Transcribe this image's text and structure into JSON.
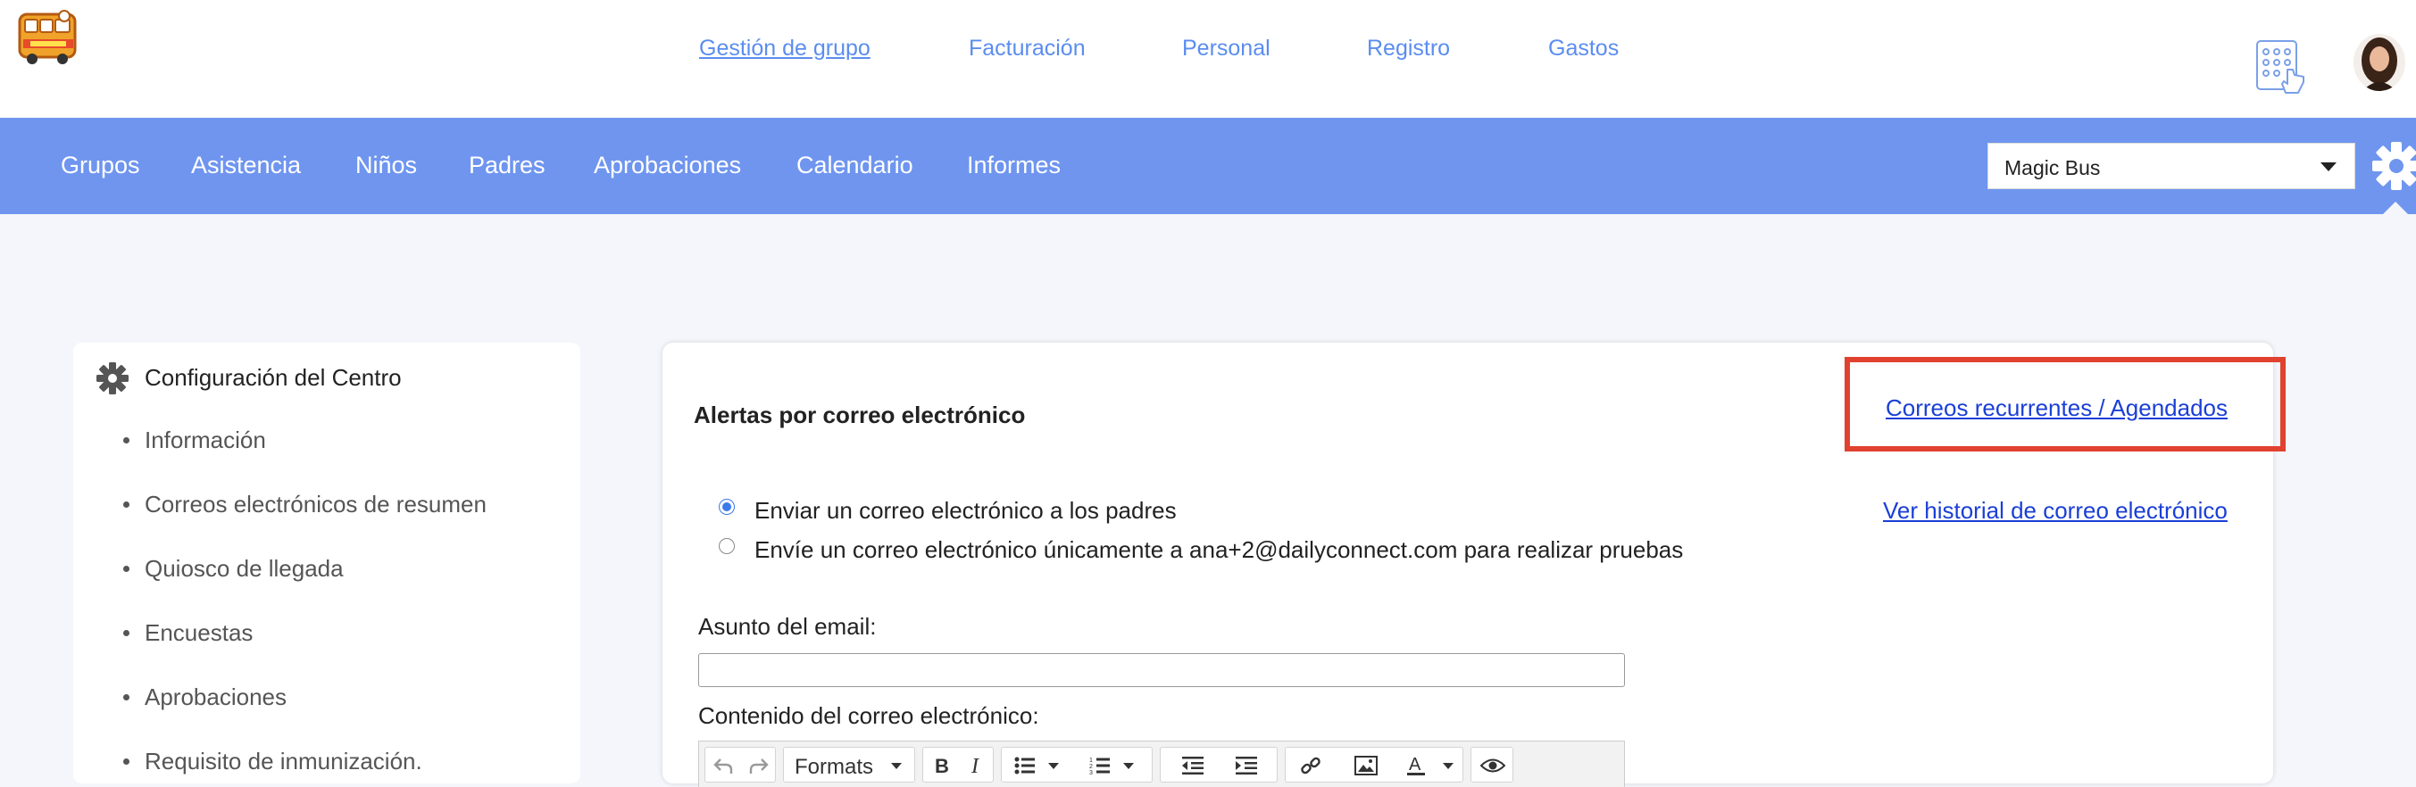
{
  "brand": {
    "logo_icon": "magic-bus-logo"
  },
  "top_nav": {
    "items": [
      {
        "label": "Gestión de grupo",
        "active": true
      },
      {
        "label": "Facturación"
      },
      {
        "label": "Personal"
      },
      {
        "label": "Registro"
      },
      {
        "label": "Gastos"
      }
    ],
    "link_color": "#5b8def"
  },
  "main_nav": {
    "background": "#6f95ef",
    "items": [
      "Grupos",
      "Asistencia",
      "Niños",
      "Padres",
      "Aprobaciones",
      "Calendario",
      "Informes"
    ]
  },
  "center_selector": {
    "value": "Magic Bus"
  },
  "sidebar": {
    "title": "Configuración del Centro",
    "items": [
      "Información",
      "Correos electrónicos de resumen",
      "Quiosco de llegada",
      "Encuestas",
      "Aprobaciones",
      "Requisito de inmunización."
    ]
  },
  "email_alerts": {
    "title": "Alertas por correo electrónico",
    "recurring_link": "Correos recurrentes / Agendados",
    "history_link": "Ver historial de correo electrónico",
    "highlight_color": "#e0422f",
    "radio_options": [
      {
        "label": "Enviar un correo electrónico a los padres",
        "selected": true
      },
      {
        "label": "Envíe un correo electrónico únicamente a ana+2@dailyconnect.com para realizar pruebas",
        "selected": false
      }
    ],
    "subject_label": "Asunto del email:",
    "subject_value": "",
    "content_label": "Contenido del correo electrónico:",
    "toolbar": {
      "formats_label": "Formats",
      "buttons": [
        "undo-icon",
        "redo-icon",
        "bold-icon",
        "italic-icon",
        "bullet-list-icon",
        "numbered-list-icon",
        "outdent-icon",
        "indent-icon",
        "link-icon",
        "image-icon",
        "text-color-icon",
        "preview-icon"
      ]
    }
  }
}
